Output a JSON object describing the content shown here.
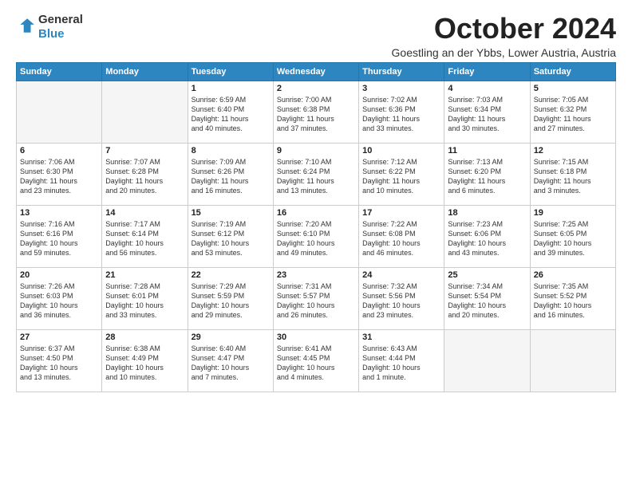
{
  "logo": {
    "line1": "General",
    "line2": "Blue"
  },
  "title": "October 2024",
  "location": "Goestling an der Ybbs, Lower Austria, Austria",
  "days_of_week": [
    "Sunday",
    "Monday",
    "Tuesday",
    "Wednesday",
    "Thursday",
    "Friday",
    "Saturday"
  ],
  "weeks": [
    [
      {
        "day": "",
        "info": ""
      },
      {
        "day": "",
        "info": ""
      },
      {
        "day": "1",
        "info": "Sunrise: 6:59 AM\nSunset: 6:40 PM\nDaylight: 11 hours\nand 40 minutes."
      },
      {
        "day": "2",
        "info": "Sunrise: 7:00 AM\nSunset: 6:38 PM\nDaylight: 11 hours\nand 37 minutes."
      },
      {
        "day": "3",
        "info": "Sunrise: 7:02 AM\nSunset: 6:36 PM\nDaylight: 11 hours\nand 33 minutes."
      },
      {
        "day": "4",
        "info": "Sunrise: 7:03 AM\nSunset: 6:34 PM\nDaylight: 11 hours\nand 30 minutes."
      },
      {
        "day": "5",
        "info": "Sunrise: 7:05 AM\nSunset: 6:32 PM\nDaylight: 11 hours\nand 27 minutes."
      }
    ],
    [
      {
        "day": "6",
        "info": "Sunrise: 7:06 AM\nSunset: 6:30 PM\nDaylight: 11 hours\nand 23 minutes."
      },
      {
        "day": "7",
        "info": "Sunrise: 7:07 AM\nSunset: 6:28 PM\nDaylight: 11 hours\nand 20 minutes."
      },
      {
        "day": "8",
        "info": "Sunrise: 7:09 AM\nSunset: 6:26 PM\nDaylight: 11 hours\nand 16 minutes."
      },
      {
        "day": "9",
        "info": "Sunrise: 7:10 AM\nSunset: 6:24 PM\nDaylight: 11 hours\nand 13 minutes."
      },
      {
        "day": "10",
        "info": "Sunrise: 7:12 AM\nSunset: 6:22 PM\nDaylight: 11 hours\nand 10 minutes."
      },
      {
        "day": "11",
        "info": "Sunrise: 7:13 AM\nSunset: 6:20 PM\nDaylight: 11 hours\nand 6 minutes."
      },
      {
        "day": "12",
        "info": "Sunrise: 7:15 AM\nSunset: 6:18 PM\nDaylight: 11 hours\nand 3 minutes."
      }
    ],
    [
      {
        "day": "13",
        "info": "Sunrise: 7:16 AM\nSunset: 6:16 PM\nDaylight: 10 hours\nand 59 minutes."
      },
      {
        "day": "14",
        "info": "Sunrise: 7:17 AM\nSunset: 6:14 PM\nDaylight: 10 hours\nand 56 minutes."
      },
      {
        "day": "15",
        "info": "Sunrise: 7:19 AM\nSunset: 6:12 PM\nDaylight: 10 hours\nand 53 minutes."
      },
      {
        "day": "16",
        "info": "Sunrise: 7:20 AM\nSunset: 6:10 PM\nDaylight: 10 hours\nand 49 minutes."
      },
      {
        "day": "17",
        "info": "Sunrise: 7:22 AM\nSunset: 6:08 PM\nDaylight: 10 hours\nand 46 minutes."
      },
      {
        "day": "18",
        "info": "Sunrise: 7:23 AM\nSunset: 6:06 PM\nDaylight: 10 hours\nand 43 minutes."
      },
      {
        "day": "19",
        "info": "Sunrise: 7:25 AM\nSunset: 6:05 PM\nDaylight: 10 hours\nand 39 minutes."
      }
    ],
    [
      {
        "day": "20",
        "info": "Sunrise: 7:26 AM\nSunset: 6:03 PM\nDaylight: 10 hours\nand 36 minutes."
      },
      {
        "day": "21",
        "info": "Sunrise: 7:28 AM\nSunset: 6:01 PM\nDaylight: 10 hours\nand 33 minutes."
      },
      {
        "day": "22",
        "info": "Sunrise: 7:29 AM\nSunset: 5:59 PM\nDaylight: 10 hours\nand 29 minutes."
      },
      {
        "day": "23",
        "info": "Sunrise: 7:31 AM\nSunset: 5:57 PM\nDaylight: 10 hours\nand 26 minutes."
      },
      {
        "day": "24",
        "info": "Sunrise: 7:32 AM\nSunset: 5:56 PM\nDaylight: 10 hours\nand 23 minutes."
      },
      {
        "day": "25",
        "info": "Sunrise: 7:34 AM\nSunset: 5:54 PM\nDaylight: 10 hours\nand 20 minutes."
      },
      {
        "day": "26",
        "info": "Sunrise: 7:35 AM\nSunset: 5:52 PM\nDaylight: 10 hours\nand 16 minutes."
      }
    ],
    [
      {
        "day": "27",
        "info": "Sunrise: 6:37 AM\nSunset: 4:50 PM\nDaylight: 10 hours\nand 13 minutes."
      },
      {
        "day": "28",
        "info": "Sunrise: 6:38 AM\nSunset: 4:49 PM\nDaylight: 10 hours\nand 10 minutes."
      },
      {
        "day": "29",
        "info": "Sunrise: 6:40 AM\nSunset: 4:47 PM\nDaylight: 10 hours\nand 7 minutes."
      },
      {
        "day": "30",
        "info": "Sunrise: 6:41 AM\nSunset: 4:45 PM\nDaylight: 10 hours\nand 4 minutes."
      },
      {
        "day": "31",
        "info": "Sunrise: 6:43 AM\nSunset: 4:44 PM\nDaylight: 10 hours\nand 1 minute."
      },
      {
        "day": "",
        "info": ""
      },
      {
        "day": "",
        "info": ""
      }
    ]
  ]
}
